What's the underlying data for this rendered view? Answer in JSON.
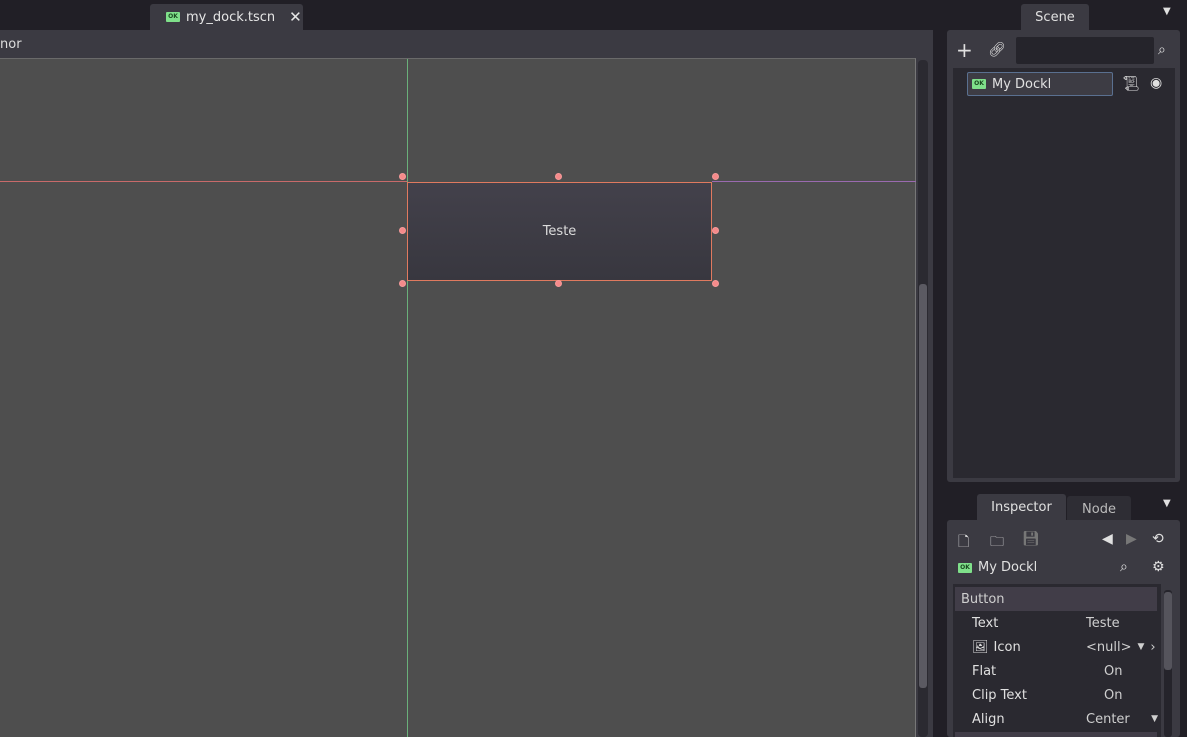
{
  "tabs": [
    {
      "label": "my_dock.tscn",
      "close": "✕"
    }
  ],
  "editor": {
    "header_text": "nor",
    "button_text": "Teste"
  },
  "scene_dock": {
    "tab": "Scene",
    "search_placeholder": "",
    "node": {
      "name": "My Dockl"
    }
  },
  "inspector": {
    "tabs": [
      "Inspector",
      "Node"
    ],
    "node_name": "My Dockl",
    "section": "Button",
    "properties": [
      {
        "name": "Text",
        "value": "Teste"
      },
      {
        "name": "Icon",
        "value": "<null>"
      },
      {
        "name": "Flat",
        "value": "On"
      },
      {
        "name": "Clip Text",
        "value": "On"
      },
      {
        "name": "Align",
        "value": "Center"
      }
    ]
  },
  "colors": {
    "accent_ok": "#7fe08a",
    "selection": "#e07a5f",
    "handle": "#f58a8a"
  }
}
